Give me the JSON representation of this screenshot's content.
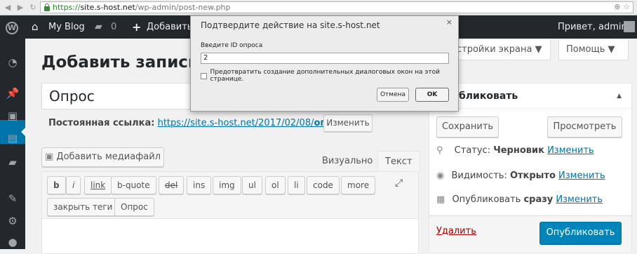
{
  "browser": {
    "url_scheme": "https://",
    "url_host": "site.s-host.net",
    "url_path": "/wp-admin/post-new.php"
  },
  "adminbar": {
    "site_name": "My Blog",
    "comments_count": "0",
    "add_new": "Добавить",
    "greeting": "Привет, admin"
  },
  "screen_options": {
    "settings": "стройки экрана ▼",
    "help": "Помощь ▼"
  },
  "page": {
    "title": "Добавить запись"
  },
  "post": {
    "title_value": "Опрос",
    "permalink_label": "Постоянная ссылка:",
    "permalink_url_prefix": "https://site.s-host.net/2017/02/08/",
    "permalink_slug": "опрос",
    "permalink_url_suffix": "/",
    "permalink_edit": "Изменить"
  },
  "editor": {
    "add_media": "Добавить медиафайл",
    "tab_visual": "Визуально",
    "tab_text": "Текст",
    "quicktags": [
      "b",
      "i",
      "link",
      "b-quote",
      "del",
      "ins",
      "img",
      "ul",
      "ol",
      "li",
      "code",
      "more"
    ],
    "close_tags": "закрыть теги",
    "poll_button": "Опрос"
  },
  "publish": {
    "heading": "бликовать",
    "save": "Сохранить",
    "preview": "Просмотреть",
    "status_label": "Статус:",
    "status_value": "Черновик",
    "status_edit": "Изменить",
    "visibility_label": "Видимость:",
    "visibility_value": "Открыто",
    "visibility_edit": "Изменить",
    "schedule_label": "Опубликовать",
    "schedule_value": "сразу",
    "schedule_edit": "Изменить",
    "trash": "Удалить",
    "publish_button": "Опубликовать"
  },
  "dialog": {
    "title": "Подтвердите действие на site.s-host.net",
    "close": "×",
    "prompt_label": "Введите ID опроса",
    "input_value": "2",
    "checkbox_label": "Предотвратить создание дополнительных диалоговых окон на этой странице.",
    "cancel": "Отмена",
    "ok": "OK"
  },
  "colors": {
    "adminbar_bg": "#23282d",
    "accent": "#0073aa",
    "publish_button": "#0085ba"
  }
}
